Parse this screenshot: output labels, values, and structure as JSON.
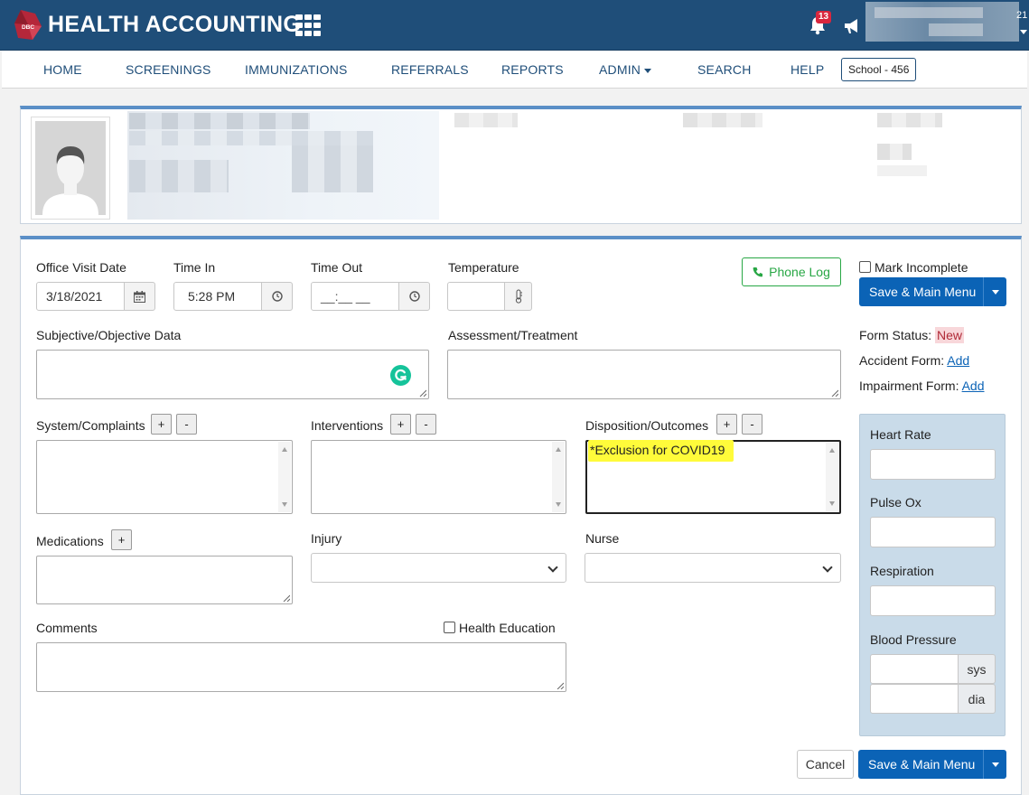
{
  "app": {
    "brand": "HEALTH ACCOUNTING",
    "logo_text": "DBC",
    "notifications_count": "13",
    "user_suffix": "21"
  },
  "nav": {
    "items": [
      "HOME",
      "SCREENINGS",
      "IMMUNIZATIONS",
      "REFERRALS",
      "REPORTS",
      "ADMIN",
      "SEARCH",
      "HELP"
    ],
    "school": "School - 456"
  },
  "form": {
    "office_visit_date": {
      "label": "Office Visit Date",
      "value": "3/18/2021"
    },
    "time_in": {
      "label": "Time In",
      "value": "5:28 PM"
    },
    "time_out": {
      "label": "Time Out",
      "placeholder": "__:__ __"
    },
    "temperature": {
      "label": "Temperature",
      "value": ""
    },
    "phone_log": "Phone Log",
    "mark_incomplete": "Mark Incomplete",
    "save_main_menu": "Save & Main Menu",
    "subjective_label": "Subjective/Objective Data",
    "assessment_label": "Assessment/Treatment",
    "form_status_label": "Form Status:",
    "form_status_value": "New",
    "accident_form_label": "Accident Form:",
    "impairment_form_label": "Impairment Form:",
    "add_link": "Add",
    "system_complaints_label": "System/Complaints",
    "interventions_label": "Interventions",
    "disposition_label": "Disposition/Outcomes",
    "disposition_value": "*Exclusion for COVID19",
    "plus": "+",
    "minus": "-",
    "medications_label": "Medications",
    "injury_label": "Injury",
    "nurse_label": "Nurse",
    "comments_label": "Comments",
    "health_education_label": "Health Education",
    "cancel": "Cancel"
  },
  "vitals": {
    "heart_rate": "Heart Rate",
    "pulse_ox": "Pulse Ox",
    "respiration": "Respiration",
    "blood_pressure": "Blood Pressure",
    "sys": "sys",
    "dia": "dia"
  },
  "colors": {
    "header": "#1f4e79",
    "primary": "#0b63b6",
    "success": "#28a745",
    "highlight": "#fffb3a",
    "badge": "#d9273e"
  }
}
